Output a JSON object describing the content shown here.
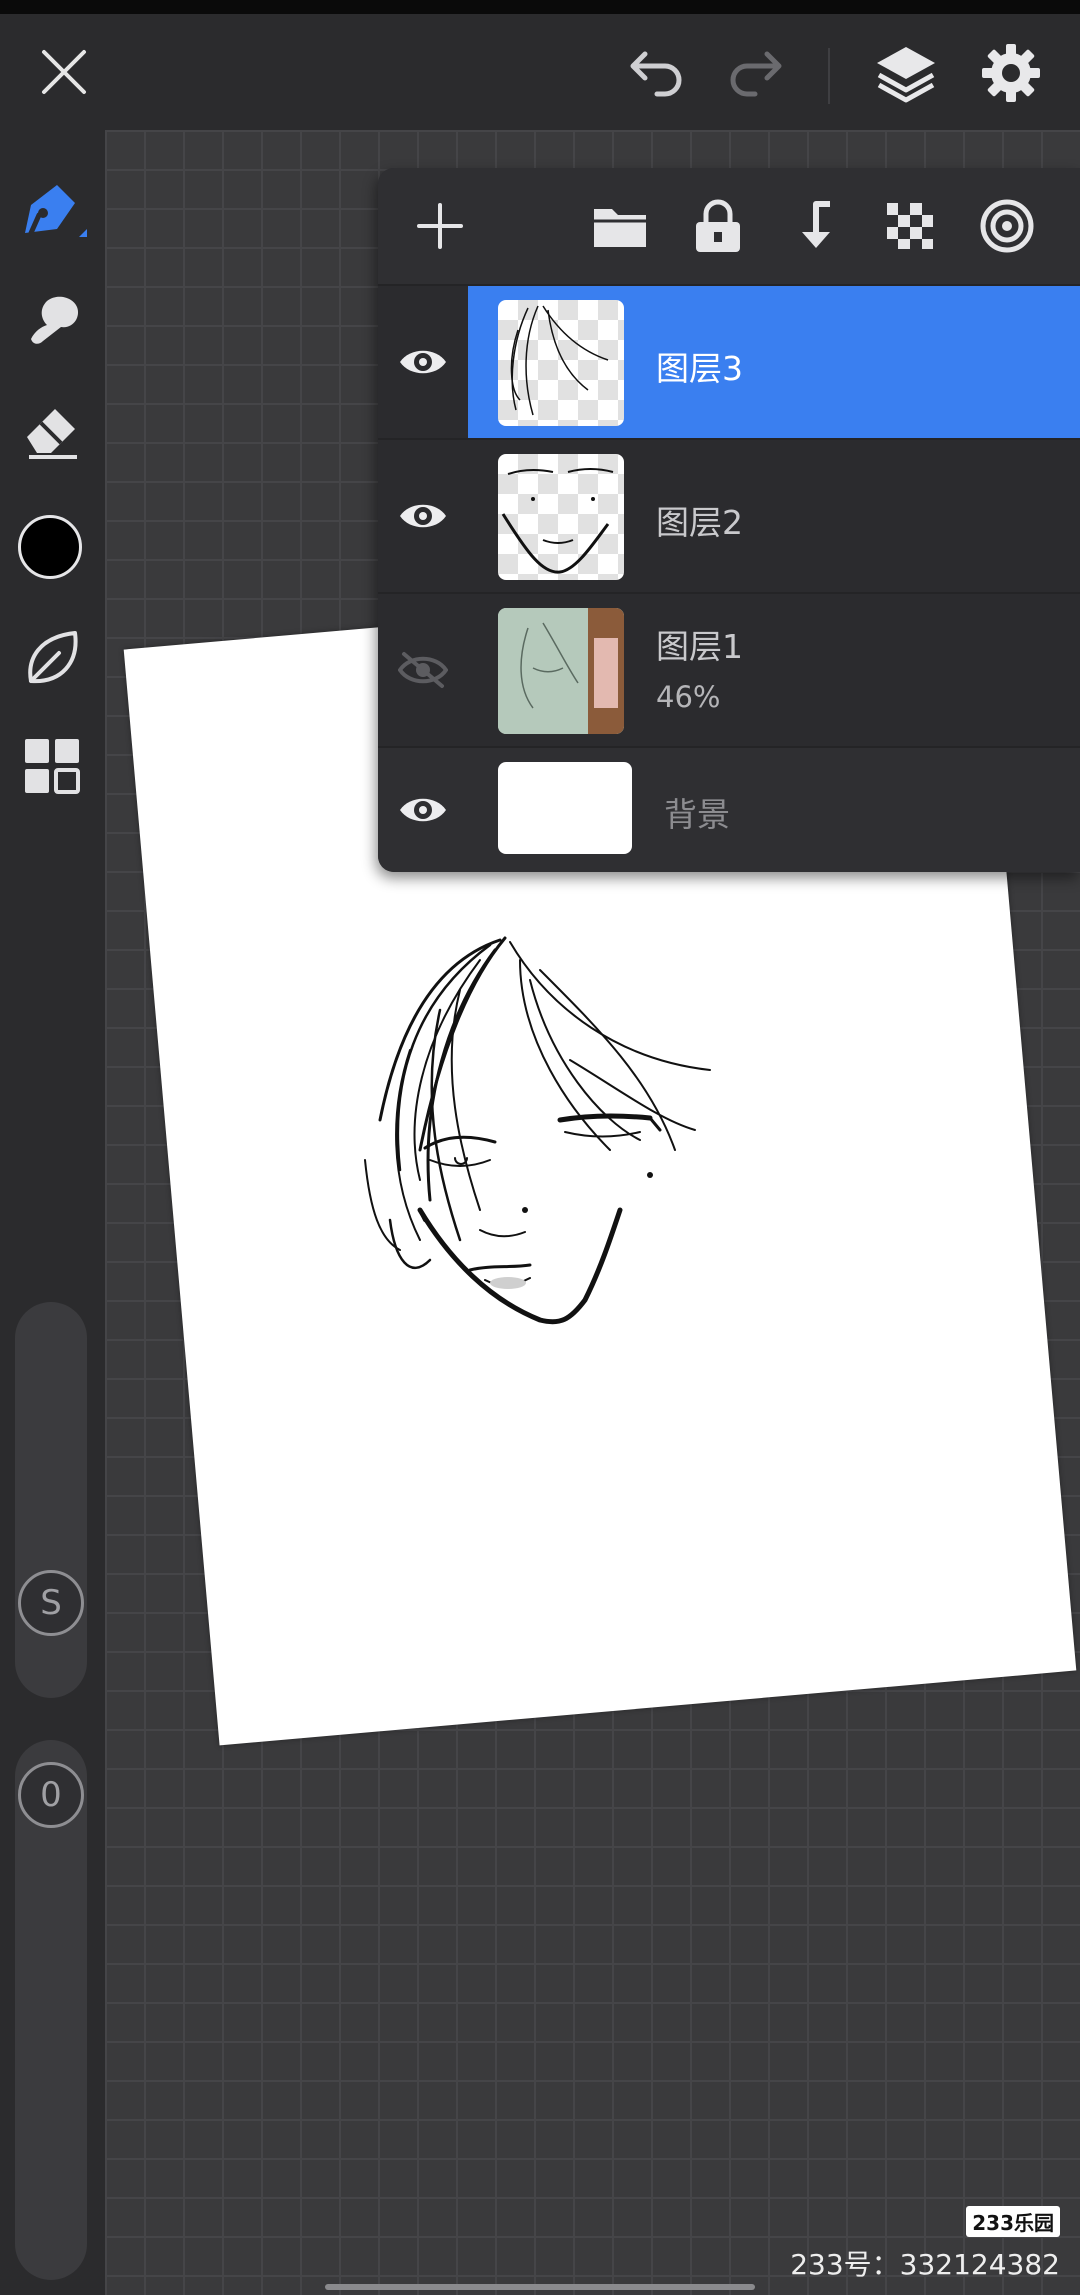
{
  "toolbar": {
    "close_icon": "close-icon",
    "undo_icon": "undo-icon",
    "redo_icon": "redo-icon",
    "layers_icon": "layers-icon",
    "settings_icon": "gear-icon"
  },
  "sidebar": {
    "tools": [
      "pen-tool",
      "smudge-tool",
      "eraser-tool",
      "color-swatch",
      "leaf-brush-tool",
      "grid-menu"
    ],
    "current_color": "#000000",
    "accent_color": "#3a7ff0",
    "size_slider_label": "S",
    "opacity_slider_label": "0"
  },
  "layers_panel": {
    "toolbar_icons": [
      "add-icon",
      "folder-icon",
      "lock-icon",
      "merge-down-icon",
      "alpha-lock-icon",
      "target-icon"
    ],
    "layers": [
      {
        "name": "图层3",
        "visible": true,
        "selected": true,
        "opacity": ""
      },
      {
        "name": "图层2",
        "visible": true,
        "selected": false,
        "opacity": ""
      },
      {
        "name": "图层1",
        "visible": false,
        "selected": false,
        "opacity": "46%"
      },
      {
        "name": "背景",
        "visible": true,
        "selected": false,
        "opacity": ""
      }
    ]
  },
  "watermark": {
    "logo": "233乐园",
    "text": "233号：332124382"
  }
}
